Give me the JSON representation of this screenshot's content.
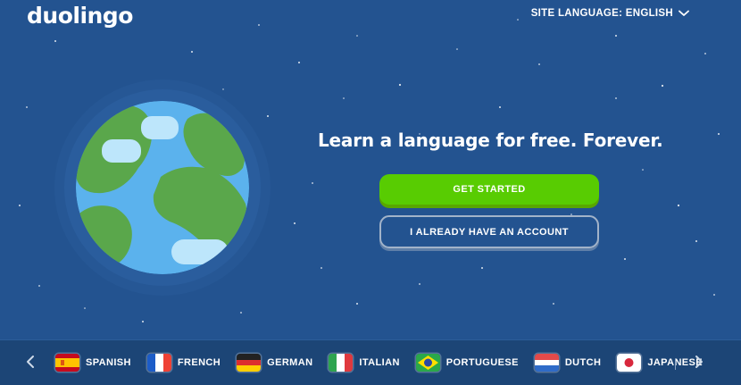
{
  "brand": {
    "logo_text": "duolingo"
  },
  "header": {
    "site_language_label": "SITE LANGUAGE: ENGLISH"
  },
  "hero": {
    "headline": "Learn a language for free. Forever.",
    "get_started_label": "GET STARTED",
    "account_label": "I ALREADY HAVE AN ACCOUNT"
  },
  "languages": [
    {
      "name": "SPANISH",
      "flag": "spain-flag-icon"
    },
    {
      "name": "FRENCH",
      "flag": "france-flag-icon"
    },
    {
      "name": "GERMAN",
      "flag": "germany-flag-icon"
    },
    {
      "name": "ITALIAN",
      "flag": "italy-flag-icon"
    },
    {
      "name": "PORTUGUESE",
      "flag": "brazil-flag-icon"
    },
    {
      "name": "DUTCH",
      "flag": "netherlands-flag-icon"
    },
    {
      "name": "JAPANESE",
      "flag": "japan-flag-icon"
    }
  ],
  "colors": {
    "background": "#235390",
    "primary_button": "#58cc02",
    "bottom_bar": "#1c4576"
  }
}
